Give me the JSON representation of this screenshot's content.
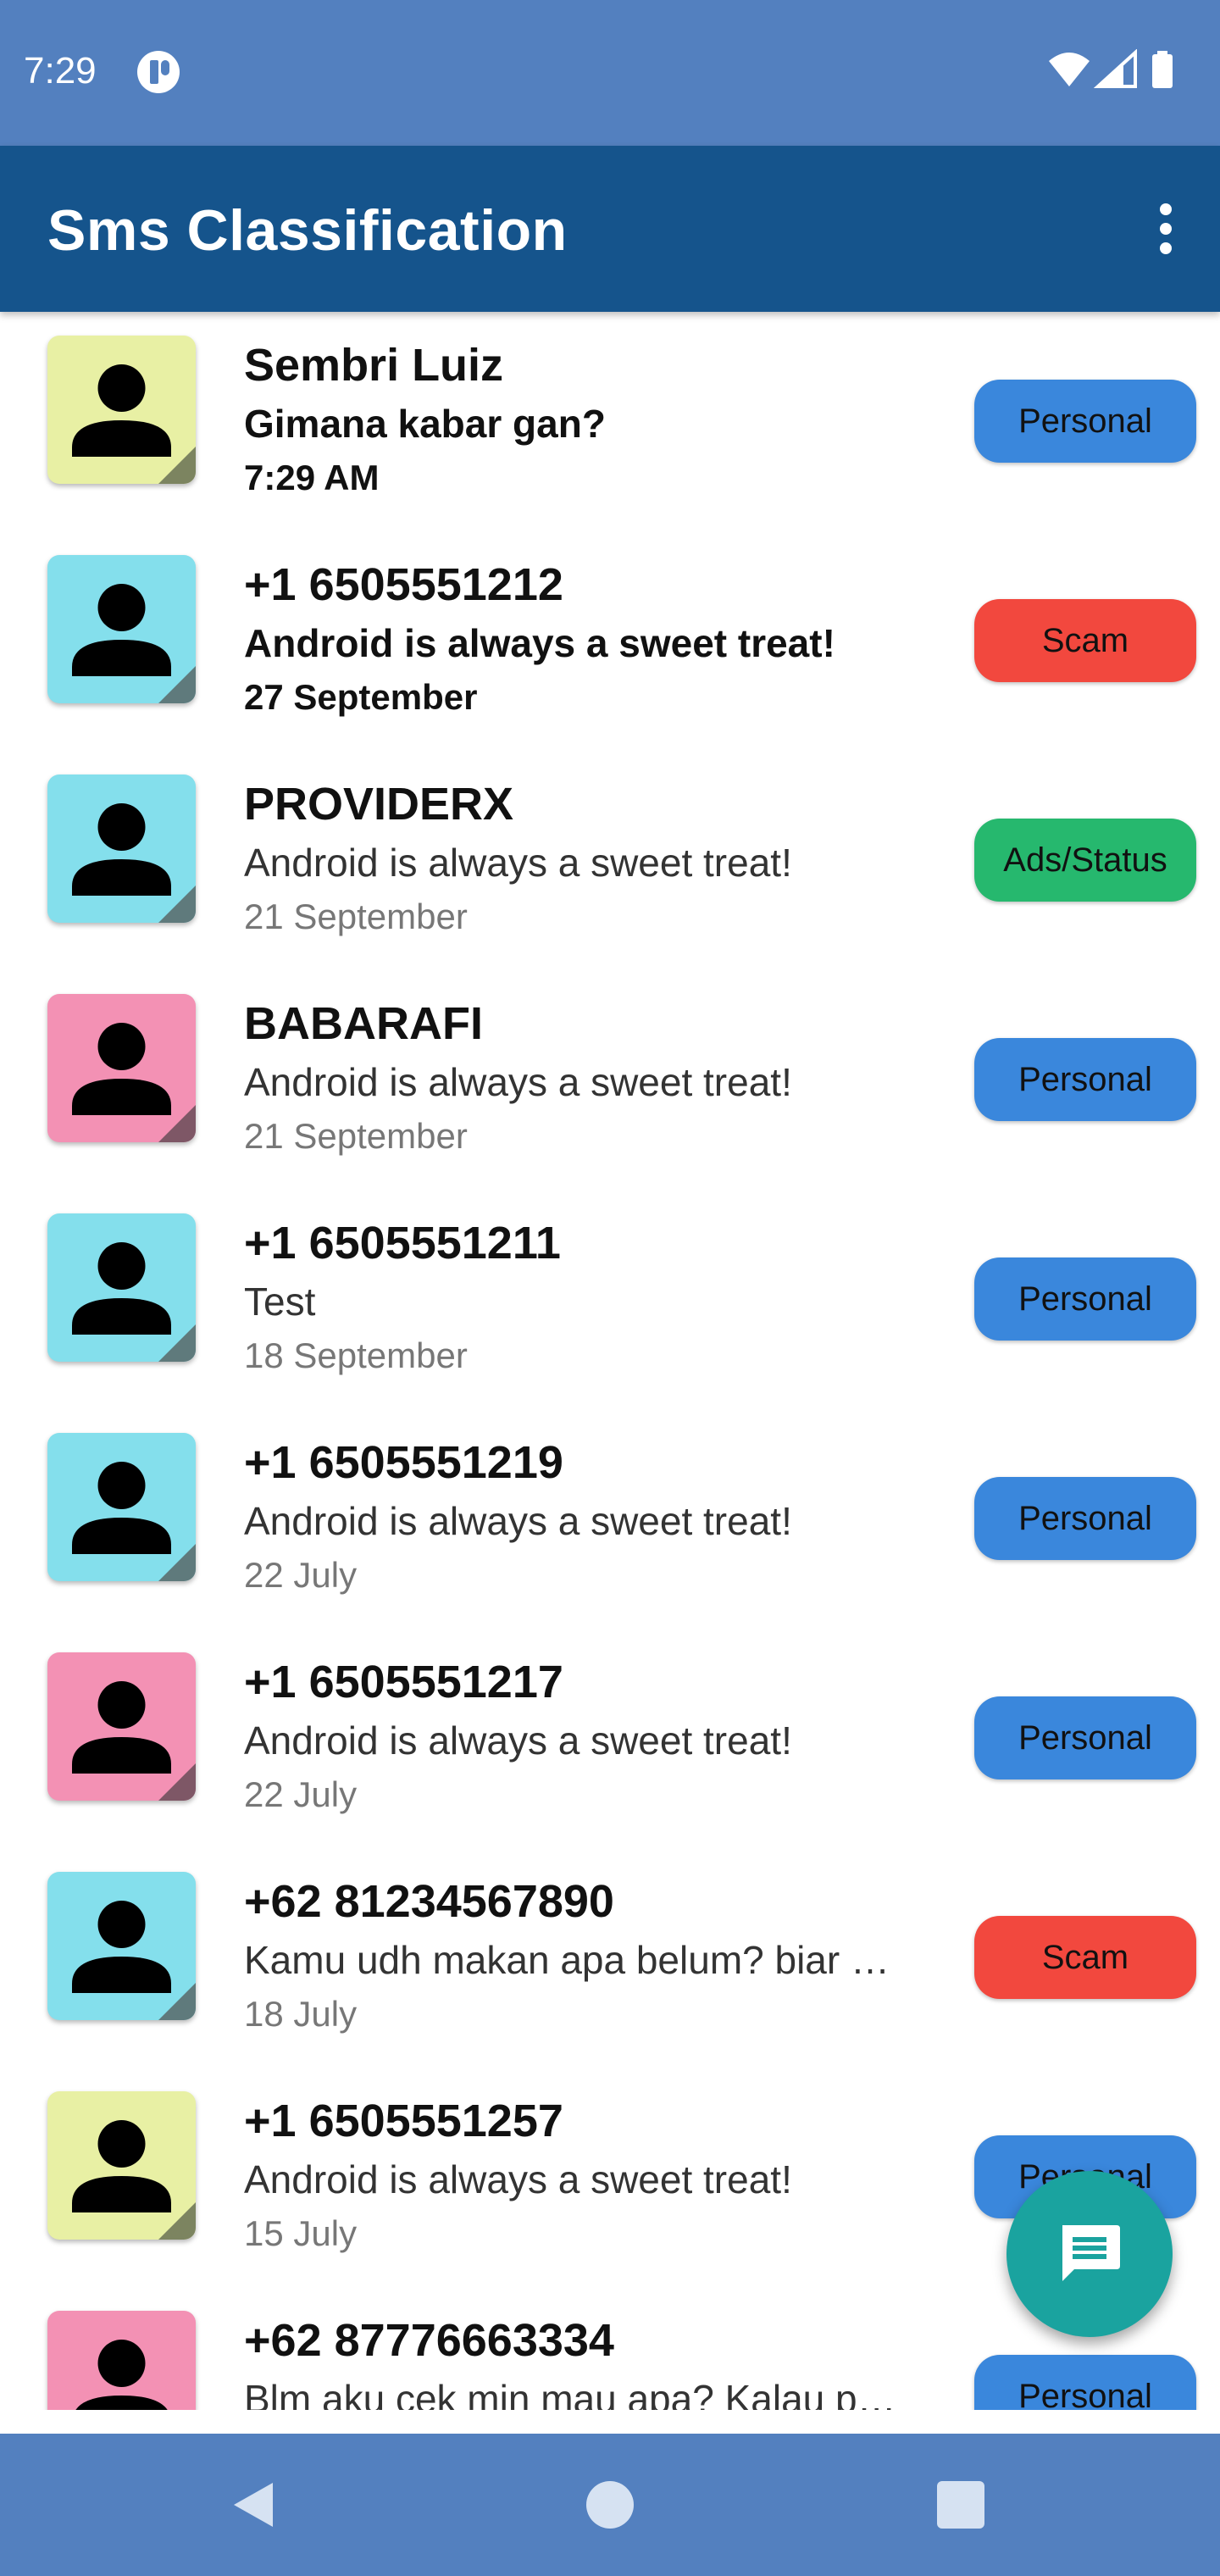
{
  "status_bar": {
    "time": "7:29",
    "app_icon": "alert-app-icon",
    "icons": [
      "wifi-icon",
      "signal-icon",
      "battery-icon"
    ]
  },
  "app_bar": {
    "title": "Sms Classification",
    "menu_icon": "more-vert-icon"
  },
  "colors": {
    "status_bar": "#5380bf",
    "app_bar": "#15548c",
    "personal": "#3a87dc",
    "scam": "#f2483e",
    "ads": "#26b86e",
    "avatar_yellow": "#e8f0a4",
    "avatar_cyan": "#84dfec",
    "avatar_pink": "#f391b4",
    "fab": "#1aa39f"
  },
  "messages": [
    {
      "sender": "Sembri Luiz",
      "preview": "Gimana kabar gan?",
      "date": "7:29 AM",
      "label": "Personal",
      "avatar_color": "yellow",
      "unread": true
    },
    {
      "sender": "+1 6505551212",
      "preview": "Android is always a sweet treat!",
      "date": "27 September",
      "label": "Scam",
      "avatar_color": "cyan",
      "unread": true
    },
    {
      "sender": "PROVIDERX",
      "preview": "Android is always a sweet treat!",
      "date": "21 September",
      "label": "Ads/Status",
      "avatar_color": "cyan",
      "unread": false
    },
    {
      "sender": "BABARAFI",
      "preview": "Android is always a sweet treat!",
      "date": "21 September",
      "label": "Personal",
      "avatar_color": "pink",
      "unread": false
    },
    {
      "sender": "+1 6505551211",
      "preview": "Test",
      "date": "18 September",
      "label": "Personal",
      "avatar_color": "cyan",
      "unread": false
    },
    {
      "sender": "+1 6505551219",
      "preview": "Android is always a sweet treat!",
      "date": "22 July",
      "label": "Personal",
      "avatar_color": "cyan",
      "unread": false
    },
    {
      "sender": "+1 6505551217",
      "preview": "Android is always a sweet treat!",
      "date": "22 July",
      "label": "Personal",
      "avatar_color": "pink",
      "unread": false
    },
    {
      "sender": "+62 81234567890",
      "preview": "Kamu udh makan apa belum? biar …",
      "date": "18 July",
      "label": "Scam",
      "avatar_color": "cyan",
      "unread": false
    },
    {
      "sender": "+1 6505551257",
      "preview": "Android is always a sweet treat!",
      "date": "15 July",
      "label": "Personal",
      "avatar_color": "yellow",
      "unread": false
    },
    {
      "sender": "+62 87776663334",
      "preview": "Blm aku cek min mau apa? Kalau p…",
      "date": "",
      "label": "Personal",
      "avatar_color": "pink",
      "unread": false
    }
  ],
  "fab": {
    "icon": "message-icon"
  },
  "nav_bar": {
    "icons": [
      "back-icon",
      "home-icon",
      "recents-icon"
    ]
  }
}
